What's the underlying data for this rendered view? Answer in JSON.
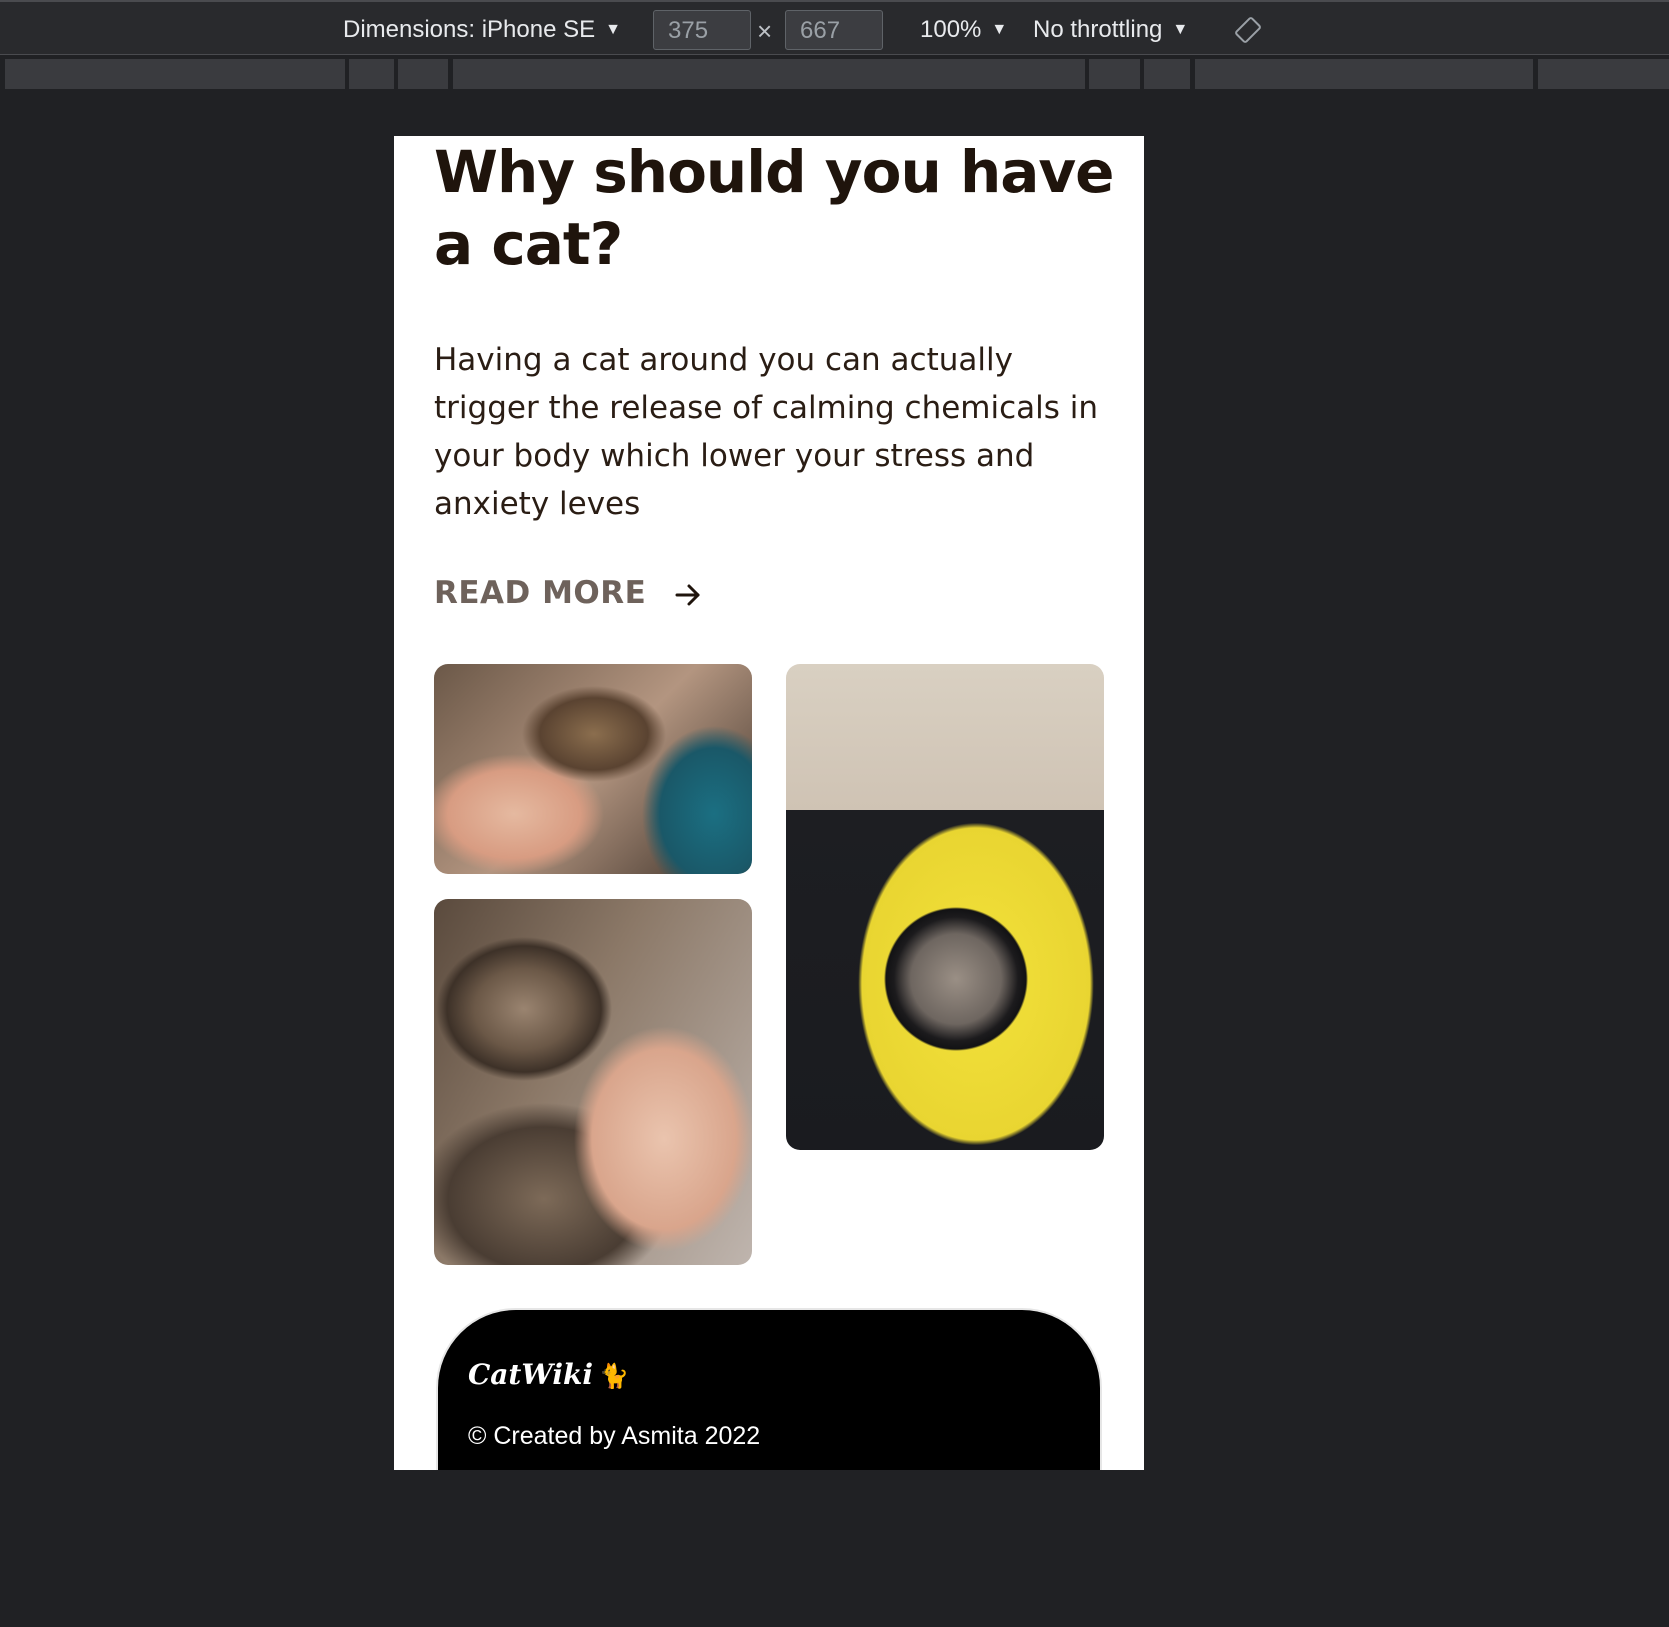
{
  "devtools": {
    "dimensions_label": "Dimensions: iPhone SE",
    "width_value": "375",
    "height_value": "667",
    "times_symbol": "×",
    "zoom": "100%",
    "throttling": "No throttling",
    "caret": "▼",
    "rotate_icon": "rotate-icon"
  },
  "page": {
    "heading": "Why should you have a cat?",
    "paragraph": "Having a cat around you can actually trigger the release of calming chemicals in your body which lower your stress and anxiety leves",
    "read_more": "READ MORE",
    "arrow_icon": "arrow-right-icon"
  },
  "images": [
    {
      "subject": "hand holding cat paw"
    },
    {
      "subject": "cat in yellow bubble backpack"
    },
    {
      "subject": "tabby cat sleeping on arm"
    }
  ],
  "footer": {
    "brand": "CatWiki",
    "brand_glyph": "🐈",
    "copyright": "© Created by Asmita 2022"
  }
}
